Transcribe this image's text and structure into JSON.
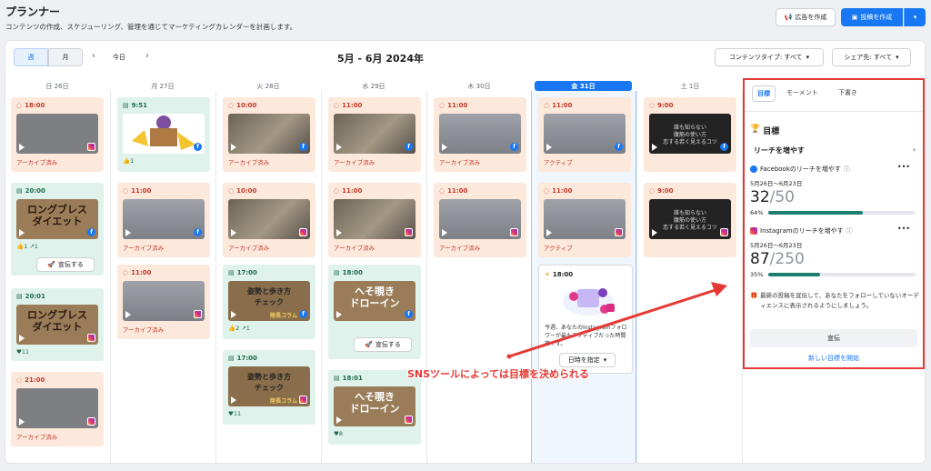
{
  "header": {
    "title": "プランナー",
    "subtitle": "コンテンツの作成、スケジューリング、管理を通じてマーケティングカレンダーを計画します。",
    "ad_btn": "広告を作成",
    "post_btn": "投稿を作成"
  },
  "toolbar": {
    "week": "週",
    "month": "月",
    "today": "今日",
    "range": "5月 - 6月 2024年",
    "content_type": "コンテンツタイプ: すべて",
    "share_to": "シェア先: すべて"
  },
  "days": [
    "日 26日",
    "月 27日",
    "火 28日",
    "水 29日",
    "木 30日",
    "金 31日",
    "土 1日"
  ],
  "labels": {
    "archived": "アーカイブ済み",
    "active": "アクティブ",
    "boost": "宣伝する"
  },
  "cards": {
    "sun": [
      {
        "time": "18:00"
      },
      {
        "time": "20:00",
        "title": "ロングブレス\nダイエット",
        "likes": "1",
        "shares": "1"
      },
      {
        "time": "20:01",
        "title": "ロングブレス\nダイエット",
        "likes": "11"
      },
      {
        "time": "21:00"
      }
    ],
    "mon": [
      {
        "time": "9:51",
        "likes": "1"
      },
      {
        "time": "11:00"
      },
      {
        "time": "11:00"
      }
    ],
    "tue": [
      {
        "time": "10:00"
      },
      {
        "time": "10:00"
      },
      {
        "time": "17:00",
        "title": "姿勢と歩き方\nチェック",
        "brand": "陸長コラム",
        "likes": "2",
        "shares": "1"
      },
      {
        "time": "17:00",
        "title": "姿勢と歩き方\nチェック",
        "brand": "陸長コラム",
        "likes": "11"
      }
    ],
    "wed": [
      {
        "time": "11:00"
      },
      {
        "time": "11:00"
      },
      {
        "time": "18:00",
        "title": "へそ覗き\nドローイン"
      },
      {
        "time": "18:01",
        "title": "へそ覗き\nドローイン",
        "likes": "8"
      }
    ],
    "thu": [
      {
        "time": "11:00"
      },
      {
        "time": "11:00"
      }
    ],
    "fri": [
      {
        "time": "11:00"
      },
      {
        "time": "11:00"
      }
    ],
    "sat": [
      {
        "time": "9:00",
        "overlay": "誰も知らない\n腹筋の使い方\n恋する若く見えるコツ"
      },
      {
        "time": "9:00",
        "overlay": "誰も知らない\n腹筋の使い方\n恋する若く見えるコツ"
      }
    ]
  },
  "suggest": {
    "time": "18:00",
    "text": "今週、あなたのInstagramフォロワーが最もアクティブだった時間帯です。",
    "button": "日時を指定"
  },
  "annotation": "SNSツールによっては目標を決められる",
  "goals": {
    "tabs": [
      "目標",
      "モーメント",
      "下書き"
    ],
    "heading": "目標",
    "reach": "リーチを増やす",
    "fb": {
      "title": "Facebookのリーチを増やす",
      "dates": "5月26日〜6月23日",
      "current": "32",
      "target": "/50",
      "percent": "64%",
      "progress": 0.64
    },
    "ig": {
      "title": "Instagramのリーチを増やす",
      "dates": "5月26日〜6月23日",
      "current": "87",
      "target": "/250",
      "percent": "35%",
      "progress": 0.35
    },
    "tip": "最新の投稿を宣伝して、あなたをフォローしていないオーディエンスに表示されるようにしましょう。",
    "promote": "宣伝",
    "new_goal": "新しい目標を開始"
  }
}
